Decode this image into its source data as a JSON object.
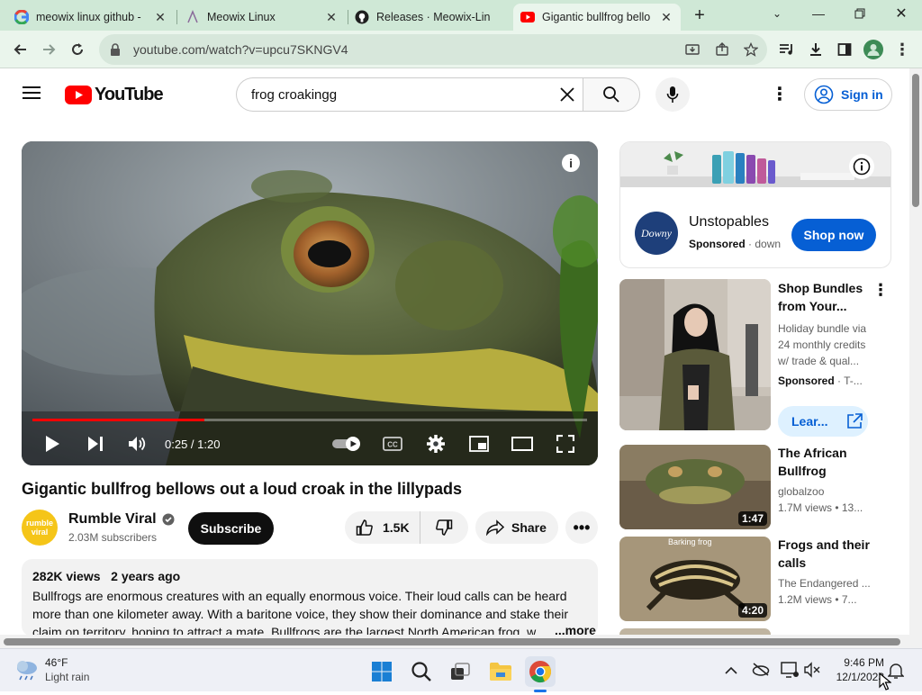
{
  "browser": {
    "tabs": [
      {
        "title": "meowix linux github -",
        "favicon": "google-icon"
      },
      {
        "title": "Meowix Linux",
        "favicon": "page-icon"
      },
      {
        "title": "Releases · Meowix-Lin",
        "favicon": "github-icon"
      },
      {
        "title": "Gigantic bullfrog bello",
        "favicon": "youtube-icon",
        "active": true
      }
    ],
    "url": "youtube.com/watch?v=upcu7SKNGV4"
  },
  "youtube": {
    "logo_text": "YouTube",
    "search_value": "frog croakingg",
    "signin_label": "Sign in"
  },
  "player": {
    "time": "0:25 / 1:20",
    "progress_fraction": 0.31
  },
  "video": {
    "title": "Gigantic bullfrog bellows out a loud croak in the lillypads",
    "channel": "Rumble Viral",
    "channel_logo_text_line1": "rumble",
    "channel_logo_text_line2": "viral",
    "subscribers": "2.03M subscribers",
    "subscribe_label": "Subscribe",
    "likes": "1.5K",
    "share_label": "Share",
    "views": "282K views",
    "age": "2 years ago",
    "description": "Bullfrogs are enormous creatures with an equally enormous voice. Their loud calls can be heard more than one kilometer away. With a baritone voice, they show their dominance and stake their claim on territory, hoping to attract a mate. Bullfrogs are the largest North American frog. w...",
    "more_label": "...more"
  },
  "sidebar": {
    "ad": {
      "brand_logo": "Downy",
      "title": "Unstopables",
      "sponsored": "Sponsored",
      "advertiser": "down",
      "cta": "Shop now"
    },
    "items": [
      {
        "title_line1": "Shop Bundles",
        "title_line2": "from Your...",
        "sub1": "Holiday bundle via",
        "sub2": "24 monthly credits",
        "sub3": "w/ trade & qual...",
        "sponsored": "Sponsored",
        "advertiser": "T-...",
        "cta": "Lear..."
      },
      {
        "title_line1": "The African",
        "title_line2": "Bullfrog",
        "channel": "globalzoo",
        "stats": "1.7M views  •  13...",
        "duration": "1:47"
      },
      {
        "title_line1": "Frogs and their",
        "title_line2": "calls",
        "channel": "The Endangered ...",
        "stats": "1.2M views  •  7...",
        "duration": "4:20",
        "thumb_caption": "Barking frog"
      }
    ]
  },
  "taskbar": {
    "weather_temp": "46°F",
    "weather_desc": "Light rain",
    "time": "9:46 PM",
    "date": "12/1/2023"
  }
}
